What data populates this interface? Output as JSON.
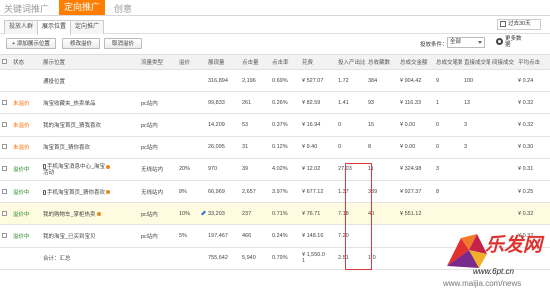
{
  "topnav": {
    "tabs": [
      "关键词推广",
      "定向推广",
      "创意"
    ],
    "active": 1
  },
  "subtabs": [
    "投放人群",
    "展示位置",
    "定向推广"
  ],
  "date_range": "过去30天",
  "toolbar": {
    "add_button": "添加展示位置",
    "edit_price_button": "修改溢价",
    "cancel_price_button": "取消溢价",
    "filter_label": "投放条件：",
    "filter_value": "全部",
    "more_label": "更多数据"
  },
  "table": {
    "headers": [
      "",
      "状态",
      "展示位置",
      "流量类型",
      "溢价",
      "",
      "展现量",
      "点击量",
      "点击率",
      "花费",
      "投入产出比",
      "总收藏数",
      "总成交金额",
      "总成交笔数",
      "直接成交笔数",
      "间接成交",
      "平均点击"
    ],
    "rows": [
      {
        "status": "",
        "status_on": false,
        "name": "通投位置",
        "name2": "",
        "icons": [],
        "traffic": "",
        "premium": "",
        "edit": false,
        "impressions": "316,894",
        "clicks": "2,196",
        "ctr": "0.69%",
        "cost": "¥ 527.07",
        "roi": "1.72",
        "fav": "384",
        "gmv": "¥ 904.42",
        "orders": "9",
        "direct": "100",
        "indirect": "",
        "cpc": "¥ 0.24",
        "highlight": false
      },
      {
        "status": "未溢价",
        "status_on": false,
        "name": "淘宝收藏夹_热卖单品",
        "name2": "",
        "icons": [],
        "traffic": "pc站内",
        "premium": "",
        "edit": false,
        "impressions": "99,833",
        "clicks": "261",
        "ctr": "0.26%",
        "cost": "¥ 82.59",
        "roi": "1.41",
        "fav": "93",
        "gmv": "¥ 116.33",
        "orders": "1",
        "direct": "13",
        "indirect": "",
        "cpc": "¥ 0.32",
        "highlight": false
      },
      {
        "status": "未溢价",
        "status_on": false,
        "name": "我的淘宝首页_猜我喜欢",
        "name2": "",
        "icons": [],
        "traffic": "pc站内",
        "premium": "",
        "edit": false,
        "impressions": "14,209",
        "clicks": "53",
        "ctr": "0.37%",
        "cost": "¥ 16.94",
        "roi": "0",
        "fav": "15",
        "gmv": "¥ 0.00",
        "orders": "0",
        "direct": "3",
        "indirect": "",
        "cpc": "¥ 0.32",
        "highlight": false
      },
      {
        "status": "未溢价",
        "status_on": false,
        "name": "淘宝首页_猜你喜欢",
        "name2": "",
        "icons": [],
        "traffic": "pc站内",
        "premium": "",
        "edit": false,
        "impressions": "26,095",
        "clicks": "31",
        "ctr": "0.12%",
        "cost": "¥ 9.40",
        "roi": "0",
        "fav": "8",
        "gmv": "¥ 0.00",
        "orders": "0",
        "direct": "3",
        "indirect": "",
        "cpc": "¥ 0.30",
        "highlight": false
      },
      {
        "status": "溢价中",
        "status_on": true,
        "name": "手机淘宝消息中心_淘宝",
        "name2": "活动",
        "icons": [
          "phone",
          "gear"
        ],
        "traffic": "无线站内",
        "premium": "20%",
        "edit": false,
        "impressions": "970",
        "clicks": "39",
        "ctr": "4.02%",
        "cost": "¥ 12.02",
        "roi": "27.03",
        "fav": "11",
        "gmv": "¥ 324.98",
        "orders": "3",
        "direct": "",
        "indirect": "",
        "cpc": "¥ 0.31",
        "highlight": false
      },
      {
        "status": "溢价中",
        "status_on": true,
        "name": "手机淘宝首页_猜你喜欢",
        "name2": "",
        "icons": [
          "phone",
          "gear"
        ],
        "traffic": "无线站内",
        "premium": "8%",
        "edit": false,
        "impressions": "66,969",
        "clicks": "2,657",
        "ctr": "3.97%",
        "cost": "¥ 677.12",
        "roi": "1.37",
        "fav": "389",
        "gmv": "¥ 927.37",
        "orders": "8",
        "direct": "",
        "indirect": "",
        "cpc": "¥ 0.25",
        "highlight": false
      },
      {
        "status": "溢价中",
        "status_on": true,
        "name": "我的购物车_掌柜热卖",
        "name2": "",
        "icons": [
          "gear"
        ],
        "traffic": "pc站内",
        "premium": "10%",
        "edit": true,
        "impressions": "33,203",
        "clicks": "237",
        "ctr": "0.71%",
        "cost": "¥ 76.71",
        "roi": "7.18",
        "fav": "40",
        "gmv": "¥ 551.12",
        "orders": "",
        "direct": "",
        "indirect": "",
        "cpc": "¥ 0.32",
        "highlight": true
      },
      {
        "status": "溢价中",
        "status_on": true,
        "name": "我的淘宝_已买到宝贝",
        "name2": "",
        "icons": [],
        "traffic": "pc站内",
        "premium": "5%",
        "edit": false,
        "impressions": "197,467",
        "clicks": "466",
        "ctr": "0.24%",
        "cost": "¥ 148.16",
        "roi": "7.20",
        "fav": "",
        "gmv": "",
        "orders": "",
        "direct": "",
        "indirect": "",
        "cpc": "¥ 0.32",
        "highlight": false
      },
      {
        "status": "",
        "status_on": false,
        "name": "合计：汇总",
        "name2": "",
        "icons": [],
        "traffic": "",
        "premium": "",
        "edit": false,
        "impressions": "755,642",
        "clicks": "5,940",
        "ctr": "0.79%",
        "cost": "¥ 1,550.0",
        "cost2": "1",
        "roi": "2.51",
        "fav": "1,0",
        "gmv": "",
        "orders": "",
        "direct": "",
        "indirect": "",
        "cpc": "",
        "highlight": false
      }
    ]
  },
  "watermark": {
    "hanzi": "乐发网",
    "url1": "www.6pt.cn",
    "url2": "www.maijia.com/news"
  },
  "colors": {
    "accent": "#ff7d00",
    "status_off": "#ff6a00",
    "status_on": "#2a8a2a",
    "highlight_box": "#e23a3a"
  }
}
